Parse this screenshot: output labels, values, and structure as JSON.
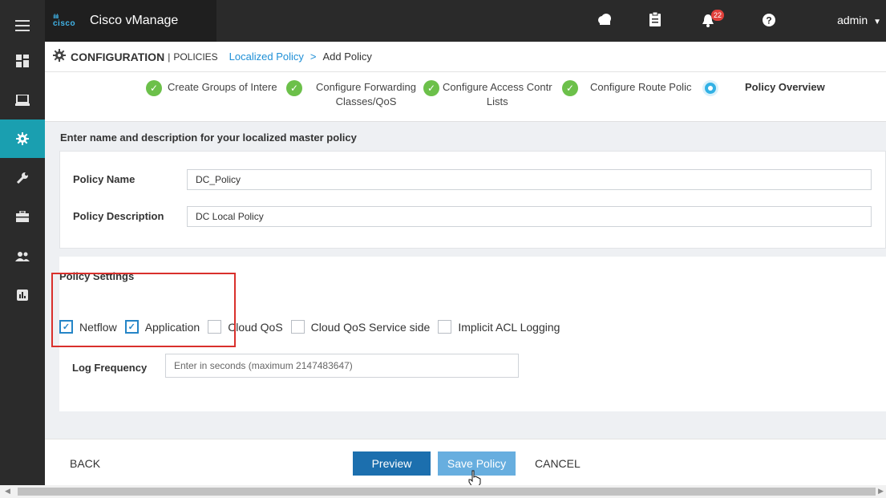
{
  "app": {
    "brand_logo_text": "cisco",
    "brand_name": "Cisco vManage"
  },
  "topbar": {
    "notification_count": "22",
    "user": "admin"
  },
  "breadcrumb": {
    "section": "CONFIGURATION",
    "separator": "|",
    "subsection": "POLICIES",
    "link": "Localized Policy",
    "arrow": ">",
    "current": "Add Policy"
  },
  "steps": [
    {
      "label": "Create Groups of Interest",
      "status": "complete"
    },
    {
      "label": "Configure Forwarding Classes/QoS",
      "status": "complete"
    },
    {
      "label": "Configure Access Control Lists",
      "status": "complete"
    },
    {
      "label": "Configure Route Policy",
      "status": "complete"
    },
    {
      "label": "Policy Overview",
      "status": "current"
    }
  ],
  "step_display": {
    "s1": "Create Groups of Intere",
    "s2_line1": "Configure Forwarding",
    "s2_line2": "Classes/QoS",
    "s3_line1": "Configure Access Contr",
    "s3_line2": "Lists",
    "s4": "Configure Route Polic",
    "s5": "Policy Overview"
  },
  "form": {
    "intro": "Enter name and description for your localized master policy",
    "name_label": "Policy Name",
    "name_value": "DC_Policy",
    "desc_label": "Policy Description",
    "desc_value": "DC Local Policy"
  },
  "settings": {
    "title": "Policy Settings",
    "options": [
      {
        "label": "Netflow",
        "checked": true
      },
      {
        "label": "Application",
        "checked": true
      },
      {
        "label": "Cloud QoS",
        "checked": false
      },
      {
        "label": "Cloud QoS Service side",
        "checked": false
      },
      {
        "label": "Implicit ACL Logging",
        "checked": false
      }
    ],
    "log_label": "Log Frequency",
    "log_placeholder": "Enter in seconds (maximum 2147483647)"
  },
  "footer": {
    "back": "BACK",
    "preview": "Preview",
    "save": "Save Policy",
    "cancel": "CANCEL"
  },
  "colors": {
    "nav_active": "#1a9fb0",
    "step_complete": "#6cc04a",
    "preview_btn": "#1c6fae",
    "save_btn": "#67aedf",
    "highlight": "#d9302c"
  }
}
